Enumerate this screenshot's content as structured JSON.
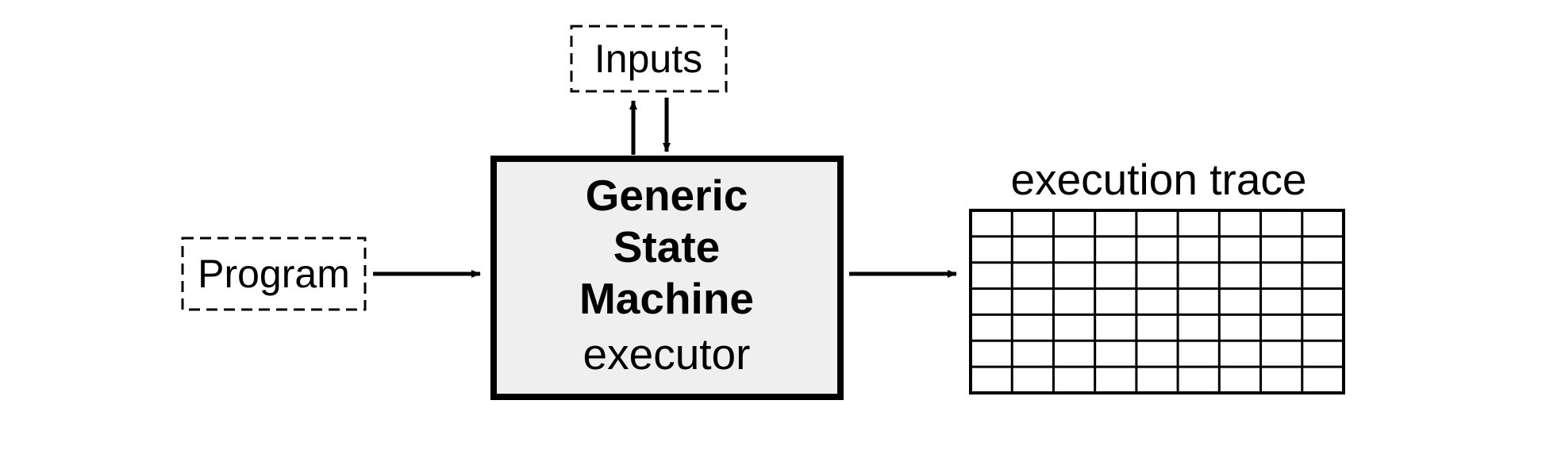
{
  "diagram": {
    "program_label": "Program",
    "inputs_label": "Inputs",
    "machine_line1": "Generic",
    "machine_line2": "State",
    "machine_line3": "Machine",
    "machine_line4": "executor",
    "trace_label": "execution trace",
    "trace_grid": {
      "rows": 7,
      "cols": 9
    }
  }
}
